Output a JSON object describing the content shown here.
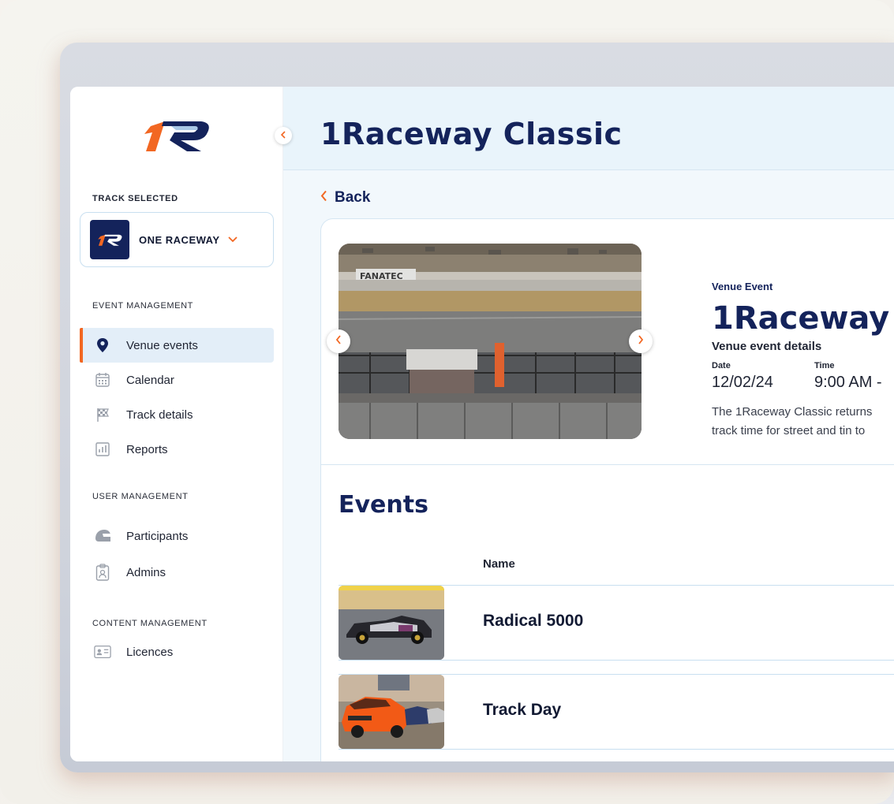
{
  "sidebar": {
    "track_selected_label": "TRACK SELECTED",
    "track_name": "ONE RACEWAY",
    "sections": {
      "event_management": "EVENT MANAGEMENT",
      "user_management": "USER MANAGEMENT",
      "content_management": "CONTENT MANAGEMENT"
    },
    "items": [
      {
        "label": "Venue events",
        "icon": "location-pin-icon",
        "active": true
      },
      {
        "label": "Calendar",
        "icon": "calendar-icon"
      },
      {
        "label": "Track details",
        "icon": "checkered-flag-icon"
      },
      {
        "label": "Reports",
        "icon": "bar-chart-icon"
      },
      {
        "label": "Participants",
        "icon": "helmet-icon"
      },
      {
        "label": "Admins",
        "icon": "id-badge-icon"
      },
      {
        "label": "Licences",
        "icon": "id-card-icon"
      }
    ]
  },
  "header": {
    "title": "1Raceway Classic"
  },
  "nav": {
    "back_label": "Back"
  },
  "venue": {
    "tag": "Venue Event",
    "title": "1Raceway",
    "subtitle": "Venue event details",
    "date_label": "Date",
    "date_value": "12/02/24",
    "time_label": "Time",
    "time_value": "9:00 AM -",
    "description_line1": "The 1Raceway Classic returns",
    "description_line2": "track time for street and tin to",
    "photo_banner": "FANATEC"
  },
  "events": {
    "title": "Events",
    "column_name": "Name",
    "rows": [
      {
        "name": "Radical 5000"
      },
      {
        "name": "Track Day"
      }
    ]
  },
  "colors": {
    "navy": "#14235b",
    "accent": "#f26722",
    "active_bg": "#e3eef8"
  }
}
